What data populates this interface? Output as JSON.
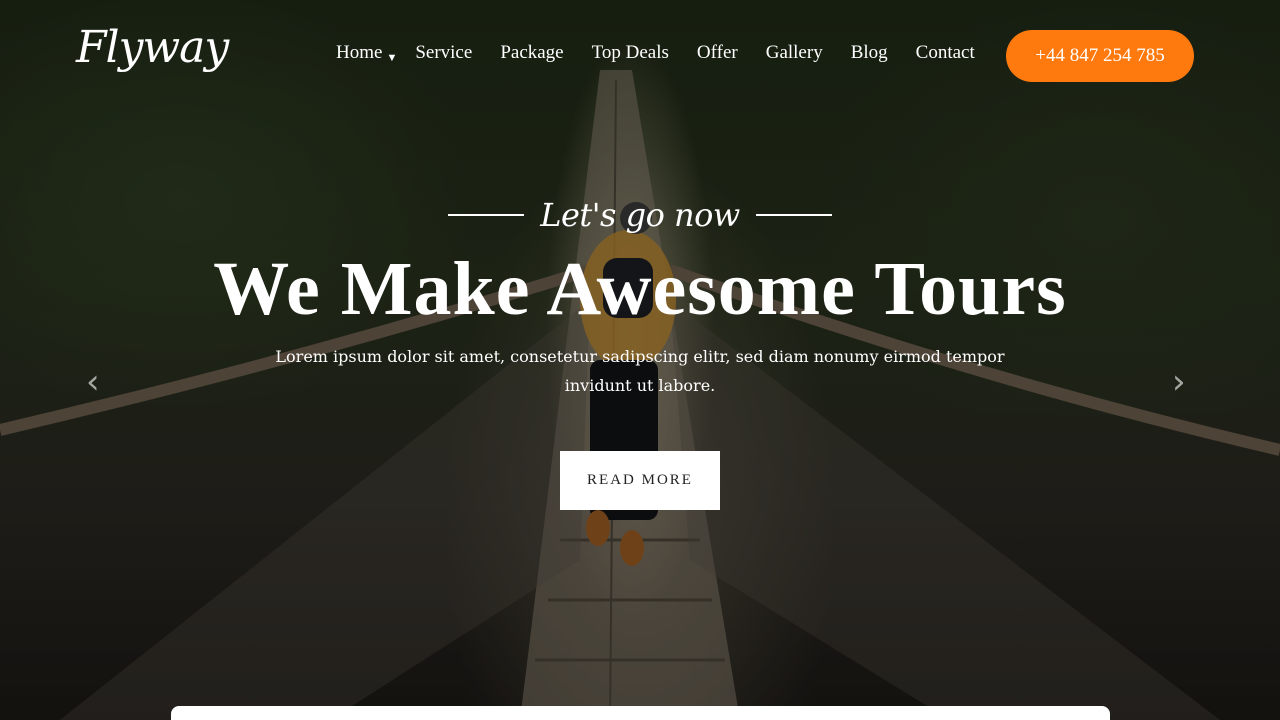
{
  "brand": {
    "logo": "Flyway",
    "accent": "#ff7a0e"
  },
  "nav": {
    "items": [
      {
        "label": "Home",
        "has_dropdown": true
      },
      {
        "label": "Service"
      },
      {
        "label": "Package"
      },
      {
        "label": "Top Deals"
      },
      {
        "label": "Offer"
      },
      {
        "label": "Gallery"
      },
      {
        "label": "Blog"
      },
      {
        "label": "Contact"
      }
    ],
    "phone": "+44 847 254 785"
  },
  "hero": {
    "kicker": "Let's go now",
    "headline": "We Make Awesome Tours",
    "subtitle": "Lorem ipsum dolor sit amet, consetetur sadipscing elitr, sed diam nonumy eirmod tempor invidunt ut labore.",
    "cta": "READ MORE",
    "prev_icon": "chevron-left-icon",
    "next_icon": "chevron-right-icon"
  }
}
